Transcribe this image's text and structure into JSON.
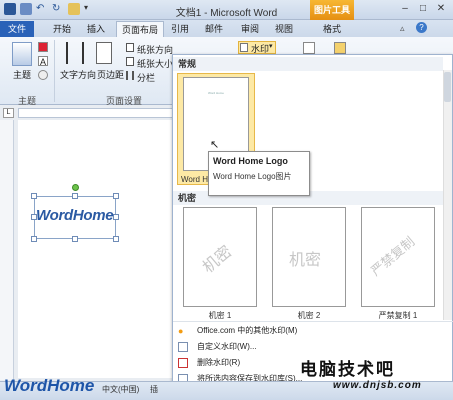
{
  "window": {
    "title": "文档1 - Microsoft Word",
    "context_tab": "图片工具",
    "buttons": {
      "minimize": "–",
      "maximize": "□",
      "close": "✕"
    }
  },
  "tabs": [
    {
      "label": "文件"
    },
    {
      "label": "开始"
    },
    {
      "label": "插入"
    },
    {
      "label": "页面布局"
    },
    {
      "label": "引用"
    },
    {
      "label": "邮件"
    },
    {
      "label": "审阅"
    },
    {
      "label": "视图"
    },
    {
      "label": "格式"
    }
  ],
  "ribbon": {
    "theme_label": "主题",
    "text_direction": "文字方向",
    "margins": "页边距",
    "paper_direction": "纸张方向",
    "paper_size": "纸张大小",
    "columns": "分栏",
    "watermark": "水印",
    "group_theme": "主题",
    "group_page_setup": "页面设置"
  },
  "watermark_menu": {
    "section_normal": "常规",
    "section_confidential": "机密",
    "selected_caption": "Word H",
    "thumbnails": [
      {
        "label": "机密 1",
        "text": "机密"
      },
      {
        "label": "机密 2",
        "text": "机密"
      },
      {
        "label": "严禁复制 1",
        "text": "严禁复制"
      }
    ],
    "thumb_top_text": "Word Home",
    "items": [
      {
        "label": "Office.com 中的其他水印(M)"
      },
      {
        "label": "自定义水印(W)..."
      },
      {
        "label": "删除水印(R)"
      },
      {
        "label": "将所选内容保存到水印库(S)..."
      }
    ]
  },
  "tooltip": {
    "title": "Word Home Logo",
    "body": "Word Home Logo图片"
  },
  "document": {
    "watermark_text": "WordHome"
  },
  "status": {
    "lang": "中文(中国)",
    "insert": "插"
  },
  "branding": {
    "logo": "WordHome",
    "chinese_logo": "电脑技术吧",
    "url": "www.dnjsb.com"
  }
}
